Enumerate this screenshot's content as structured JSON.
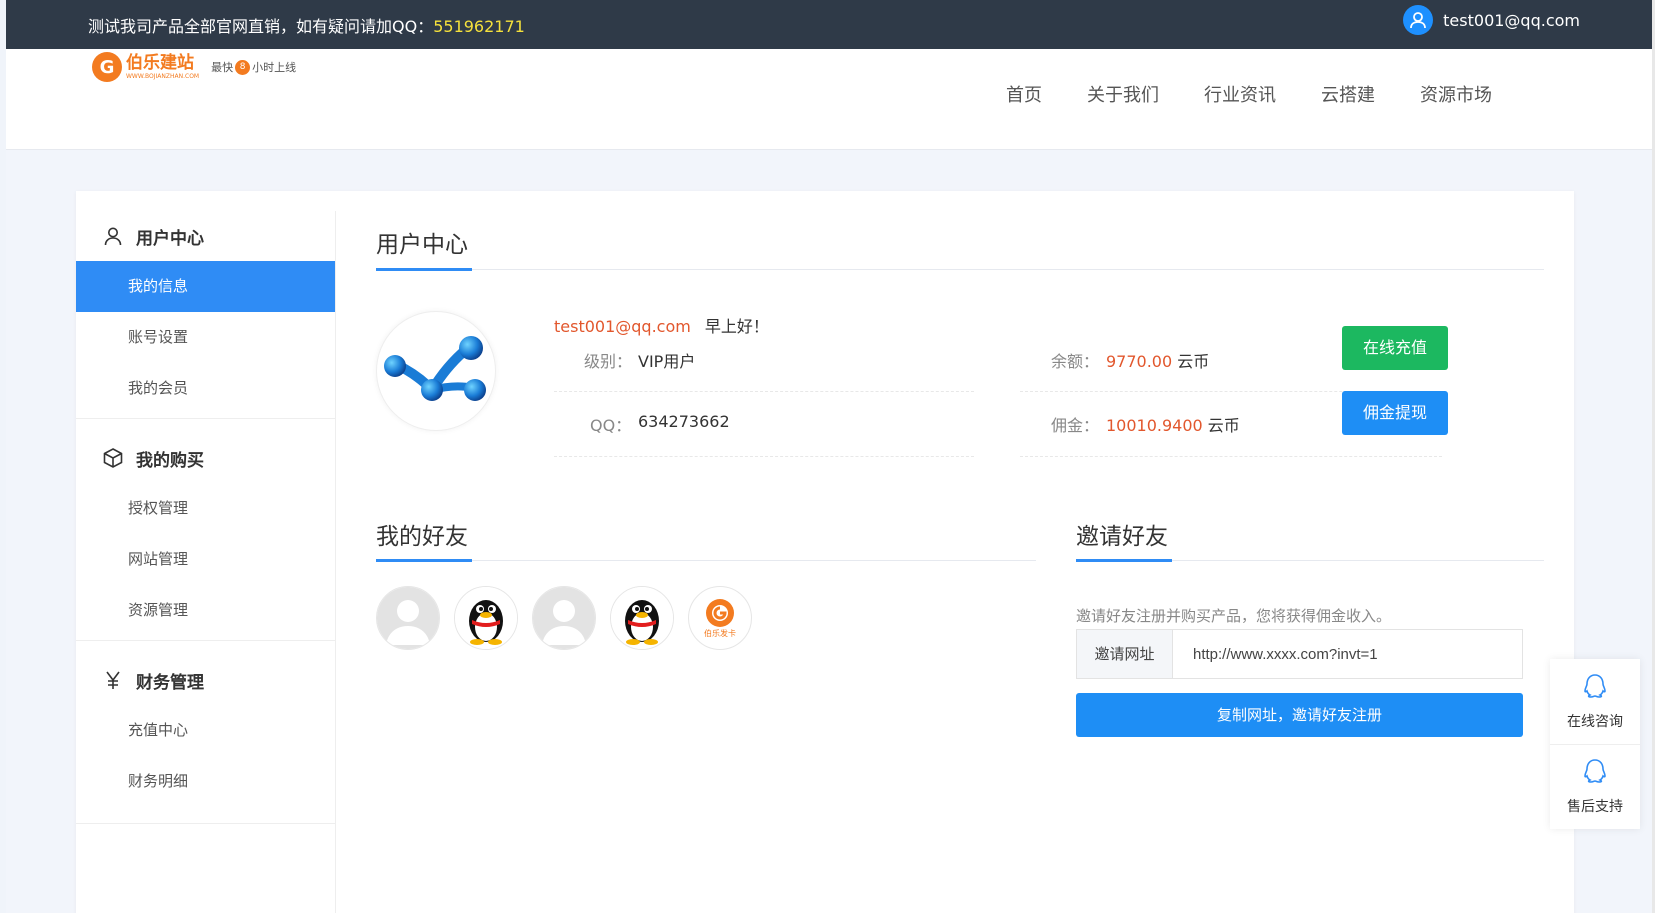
{
  "topbar": {
    "notice_prefix": "测试我司产品全部官网直销，如有疑问请加QQ：",
    "qq": "551962171",
    "user_email": "test001@qq.com"
  },
  "header": {
    "logo_name": "伯乐建站",
    "logo_url": "WWW.BOJIANZHAN.COM",
    "slogan_prefix": "最快",
    "slogan_num": "8",
    "slogan_suffix": "小时上线",
    "nav": [
      "首页",
      "关于我们",
      "行业资讯",
      "云搭建",
      "资源市场"
    ]
  },
  "sidebar": {
    "groups": [
      {
        "title": "用户中心",
        "icon": "user-icon",
        "items": [
          "我的信息",
          "账号设置",
          "我的会员"
        ]
      },
      {
        "title": "我的购买",
        "icon": "box-icon",
        "items": [
          "授权管理",
          "网站管理",
          "资源管理"
        ]
      },
      {
        "title": "财务管理",
        "icon": "yen-icon",
        "items": [
          "充值中心",
          "财务明细"
        ]
      }
    ],
    "active_item": "我的信息"
  },
  "user_center": {
    "title": "用户中心",
    "email": "test001@qq.com",
    "greeting": "早上好！",
    "level_label": "级别：",
    "level_value": "VIP用户",
    "qq_label": "QQ：",
    "qq_value": "634273662",
    "balance_label": "余额：",
    "balance_value": "9770.00",
    "commission_label": "佣金：",
    "commission_value": "10010.9400",
    "currency": "云币",
    "recharge_button": "在线充值",
    "withdraw_button": "佣金提现"
  },
  "friends": {
    "title": "我的好友",
    "list": [
      "default-avatar",
      "qq-penguin-avatar",
      "default-avatar",
      "qq-penguin-avatar",
      "bole-logo-avatar"
    ],
    "bole_label": "伯乐发卡"
  },
  "invite": {
    "title": "邀请好友",
    "description": "邀请好友注册并购买产品，您将获得佣金收入。",
    "url_label": "邀请网址",
    "url_value": "http://www.xxxx.com?invt=1",
    "copy_button": "复制网址，邀请好友注册"
  },
  "float_service": {
    "items": [
      "在线咨询",
      "售后支持"
    ]
  },
  "colors": {
    "accent": "#2f8cf5",
    "topbar": "#2f3a48",
    "highlight": "#e2572d",
    "green": "#1cb860",
    "qq_yellow": "#f5e13c"
  }
}
